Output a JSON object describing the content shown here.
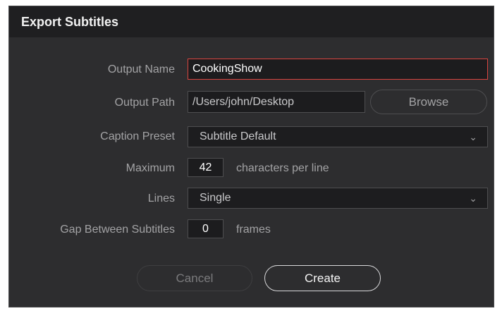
{
  "dialog": {
    "title": "Export Subtitles"
  },
  "form": {
    "output_name": {
      "label": "Output Name",
      "value": "CookingShow"
    },
    "output_path": {
      "label": "Output Path",
      "value": "/Users/john/Desktop",
      "browse_label": "Browse"
    },
    "caption_preset": {
      "label": "Caption Preset",
      "value": "Subtitle Default",
      "icon": "chevron-down-icon"
    },
    "maximum": {
      "label": "Maximum",
      "value": "42",
      "suffix": "characters per line"
    },
    "lines": {
      "label": "Lines",
      "value": "Single",
      "icon": "chevron-down-icon"
    },
    "gap": {
      "label": "Gap Between Subtitles",
      "value": "0",
      "suffix": "frames"
    }
  },
  "buttons": {
    "cancel": "Cancel",
    "create": "Create"
  },
  "colors": {
    "active_border": "#d9443f",
    "dialog_bg": "#2d2d2f",
    "titlebar_bg": "#1f1f21"
  }
}
